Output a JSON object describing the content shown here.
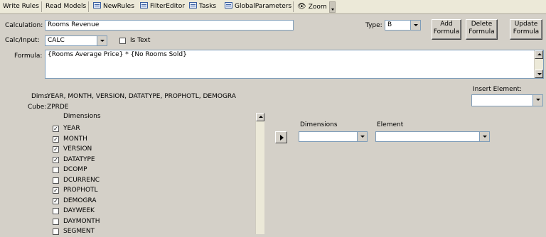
{
  "toolbar": {
    "write_rules": "Write Rules",
    "read_models": "Read Models",
    "new_rules": "NewRules",
    "filter_editor": "FilterEditor",
    "tasks": "Tasks",
    "global_parameters": "GlobalParameters",
    "zoom": "Zoom"
  },
  "form": {
    "calculation_label": "Calculation:",
    "calculation_value": "Rooms Revenue",
    "calc_input_label": "Calc/Input:",
    "calc_input_value": "CALC",
    "is_text_label": "Is Text",
    "is_text_checked": false,
    "type_label": "Type:",
    "type_value": "B",
    "formula_label": "Formula:",
    "formula_value": "{Rooms Average Price} * {No Rooms Sold}",
    "insert_element_label": "Insert Element:",
    "insert_element_value": ""
  },
  "buttons": {
    "add_formula": [
      "Add",
      "Formula"
    ],
    "delete_formula": [
      "Delete",
      "Formula"
    ],
    "update_formula": [
      "Update",
      "Formula"
    ]
  },
  "info": {
    "dims_label": "Dims:",
    "dims_value": "YEAR, MONTH, VERSION, DATATYPE, PROPHOTL, DEMOGRA",
    "cube_label": "Cube:",
    "cube_value": "ZPRDE"
  },
  "dimensions_list": {
    "header": "Dimensions",
    "items": [
      {
        "label": "YEAR",
        "checked": true
      },
      {
        "label": "MONTH",
        "checked": true
      },
      {
        "label": "VERSION",
        "checked": true
      },
      {
        "label": "DATATYPE",
        "checked": true
      },
      {
        "label": "DCOMP",
        "checked": false
      },
      {
        "label": "DCURRENC",
        "checked": false
      },
      {
        "label": "PROPHOTL",
        "checked": true
      },
      {
        "label": "DEMOGRA",
        "checked": true
      },
      {
        "label": "DAYWEEK",
        "checked": false
      },
      {
        "label": "DAYMONTH",
        "checked": false
      },
      {
        "label": "SEGMENT",
        "checked": false
      }
    ]
  },
  "element_picker": {
    "dimensions_label": "Dimensions",
    "dimensions_value": "",
    "element_label": "Element",
    "element_value": ""
  },
  "colors": {
    "background": "#d4d0c8",
    "toolbar": "#ece9d8",
    "input_border": "#7f9db9"
  }
}
